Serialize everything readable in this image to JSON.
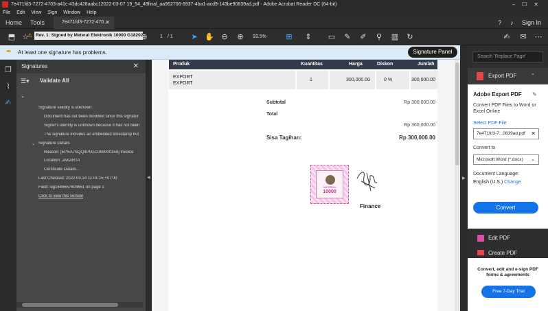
{
  "window": {
    "title": "7e471fd3-7272-4703-a41c-43dc428aabc12022-03-07 19_54_49final_aa952706-6937-4ba1-acd9-143be90839ad.pdf - Adobe Acrobat Reader DC (64-bit)"
  },
  "menu": [
    "File",
    "Edit",
    "View",
    "Sign",
    "Window",
    "Help"
  ],
  "tabs": {
    "home": "Home",
    "tools": "Tools",
    "doc": "7e471fd3-7272-470..."
  },
  "account": {
    "sign_in": "Sign In"
  },
  "toolbar": {
    "page_current": "1",
    "page_total": "/ 1",
    "zoom": "93.5%"
  },
  "sigbar": {
    "message": "At least one signature has problems.",
    "panel_button": "Signature Panel"
  },
  "signatures": {
    "title": "Signatures",
    "validate_all": "Validate All",
    "rev": "Rev. 1: Signed by Meteral Elektronik 10000 G182022",
    "details": [
      "Signature validity is unknown:",
      "Document has not been modified since this signatur",
      "Signer's identity is unknown because it has not been",
      "The signature includes an embedded timestamp but"
    ],
    "sig_details_label": "Signature Details",
    "reason": "Reason: [EPSA7SQQ4P0GC069000159] Invoice",
    "location": "Location: JAKARTA",
    "cert": "Certificate Details...",
    "last_checked": "Last Checked: 2022.03.14 11:01:15 +07'00'",
    "field": "Field: sig1646657604651 on page 1",
    "click_link": "Click to view this version"
  },
  "document": {
    "headers": {
      "produk": "Produk",
      "kuantitas": "Kuantitas",
      "harga": "Harga",
      "diskon": "Diskon",
      "jumlah": "Jumlah"
    },
    "row": {
      "produk": "EXPORT",
      "produk_sub": "EXPORT",
      "kuantitas": "1",
      "harga": "300,000.00",
      "diskon": "0 %",
      "jumlah": "300,000.00"
    },
    "subtotal_label": "Subtotal",
    "subtotal_value": "Rp 300,000.00",
    "total_label": "Total",
    "total_value": "Rp 300,000.00",
    "sisa_label": "Sisa Tagihan:",
    "sisa_value": "Rp 300,000.00",
    "stamp_caption": "METERAI",
    "stamp_value": "10000",
    "signer": "Finance"
  },
  "right_pane": {
    "search_placeholder": "Search 'Replace Page'",
    "export_header": "Export PDF",
    "title": "Adobe Export PDF",
    "desc": "Convert PDF Files to Word or Excel Online",
    "select_label": "Select PDF File",
    "file_name": "7e471fd3-7...0839ad.pdf",
    "convert_to_label": "Convert to",
    "convert_option": "Microsoft Word (*.docx)",
    "lang_label": "Document Language:",
    "lang_value": "English (U.S.)",
    "lang_change": "Change",
    "convert_button": "Convert",
    "edit_pdf": "Edit PDF",
    "create_pdf": "Create PDF",
    "promo_text": "Convert, edit and e-sign PDF forms & agreements",
    "trial_button": "Free 7-Day Trial"
  },
  "colors": {
    "accent": "#1473e6",
    "table_header": "#333b4a",
    "warning": "#e7b400"
  }
}
